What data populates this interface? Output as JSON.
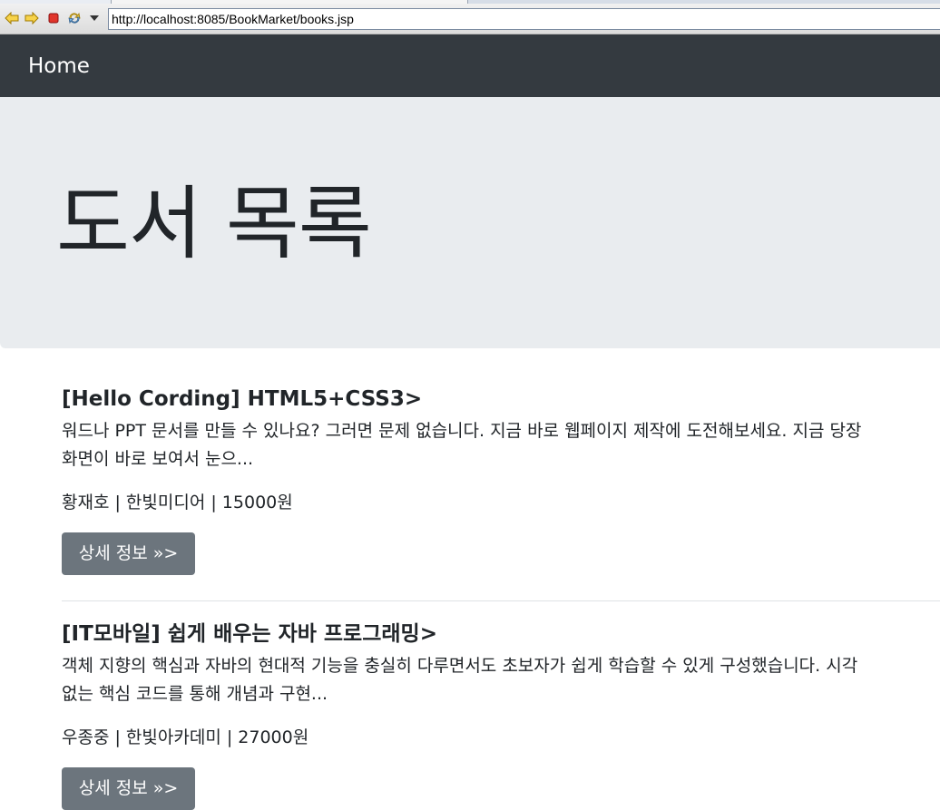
{
  "browser": {
    "url": "http://localhost:8085/BookMarket/books.jsp",
    "icons": [
      "back-arrow-icon",
      "forward-arrow-icon",
      "stop-icon",
      "refresh-icon",
      "dropdown-arrow-icon"
    ]
  },
  "navbar": {
    "brand": "Home",
    "bg_color": "#343a40"
  },
  "jumbotron": {
    "title": "도서 목록",
    "bg_color": "#e9ecef"
  },
  "books": [
    {
      "title": "[Hello Cording] HTML5+CSS3>",
      "description_line1": "워드나 PPT 문서를 만들 수 있나요? 그러면 문제 없습니다. 지금 바로 웹페이지 제작에 도전해보세요. 지금 당장",
      "description_line2": "화면이 바로 보여서 눈으...",
      "meta": "황재호 | 한빛미디어 | 15000원",
      "button_label": "상세 정보 »>"
    },
    {
      "title": "[IT모바일] 쉽게 배우는 자바 프로그래밍>",
      "description_line1": "객체 지향의 핵심과 자바의 현대적 기능을 충실히 다루면서도 초보자가 쉽게 학습할 수 있게 구성했습니다. 시각",
      "description_line2": "없는 핵심 코드를 통해 개념과 구현...",
      "meta": "우종중 | 한빛아카데미 | 27000원",
      "button_label": "상세 정보 »>"
    }
  ],
  "colors": {
    "button_bg": "#6c757d",
    "text": "#212529"
  }
}
